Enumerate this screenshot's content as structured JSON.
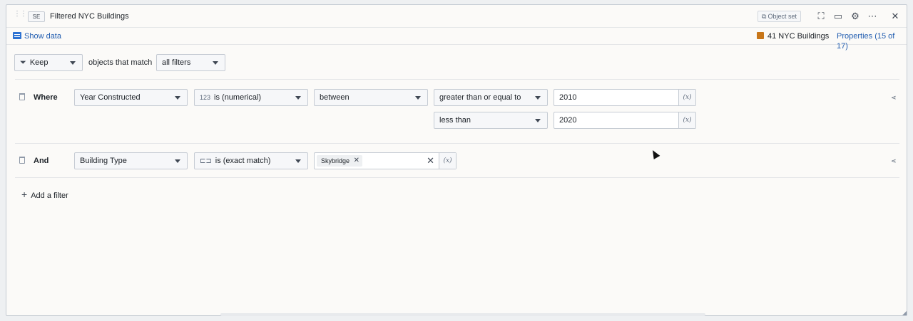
{
  "titlebar": {
    "badge": "SE",
    "title": "Filtered NYC Buildings",
    "object_set_label": "Object set",
    "icons": [
      "fullscreen-icon",
      "present-icon",
      "gear-icon",
      "more-icon",
      "close-icon"
    ]
  },
  "subbar": {
    "show_data_label": "Show data",
    "count_label": "41 NYC Buildings",
    "properties_label": "Properties (15 of 17)"
  },
  "filter_header": {
    "mode_value": "Keep",
    "middle_text": "objects that match",
    "match_value": "all filters"
  },
  "filters": [
    {
      "connector": "Where",
      "property": "Year Constructed",
      "type_prefix": "123",
      "type": "is (numerical)",
      "operator": "between",
      "conditions": [
        {
          "comparator": "greater than or equal to",
          "value": "2010"
        },
        {
          "comparator": "less than",
          "value": "2020"
        }
      ]
    },
    {
      "connector": "And",
      "property": "Building Type",
      "type": "is (exact match)",
      "tag": "Skybridge"
    }
  ],
  "variable_label": "(x)",
  "add_filter_label": "Add a filter"
}
